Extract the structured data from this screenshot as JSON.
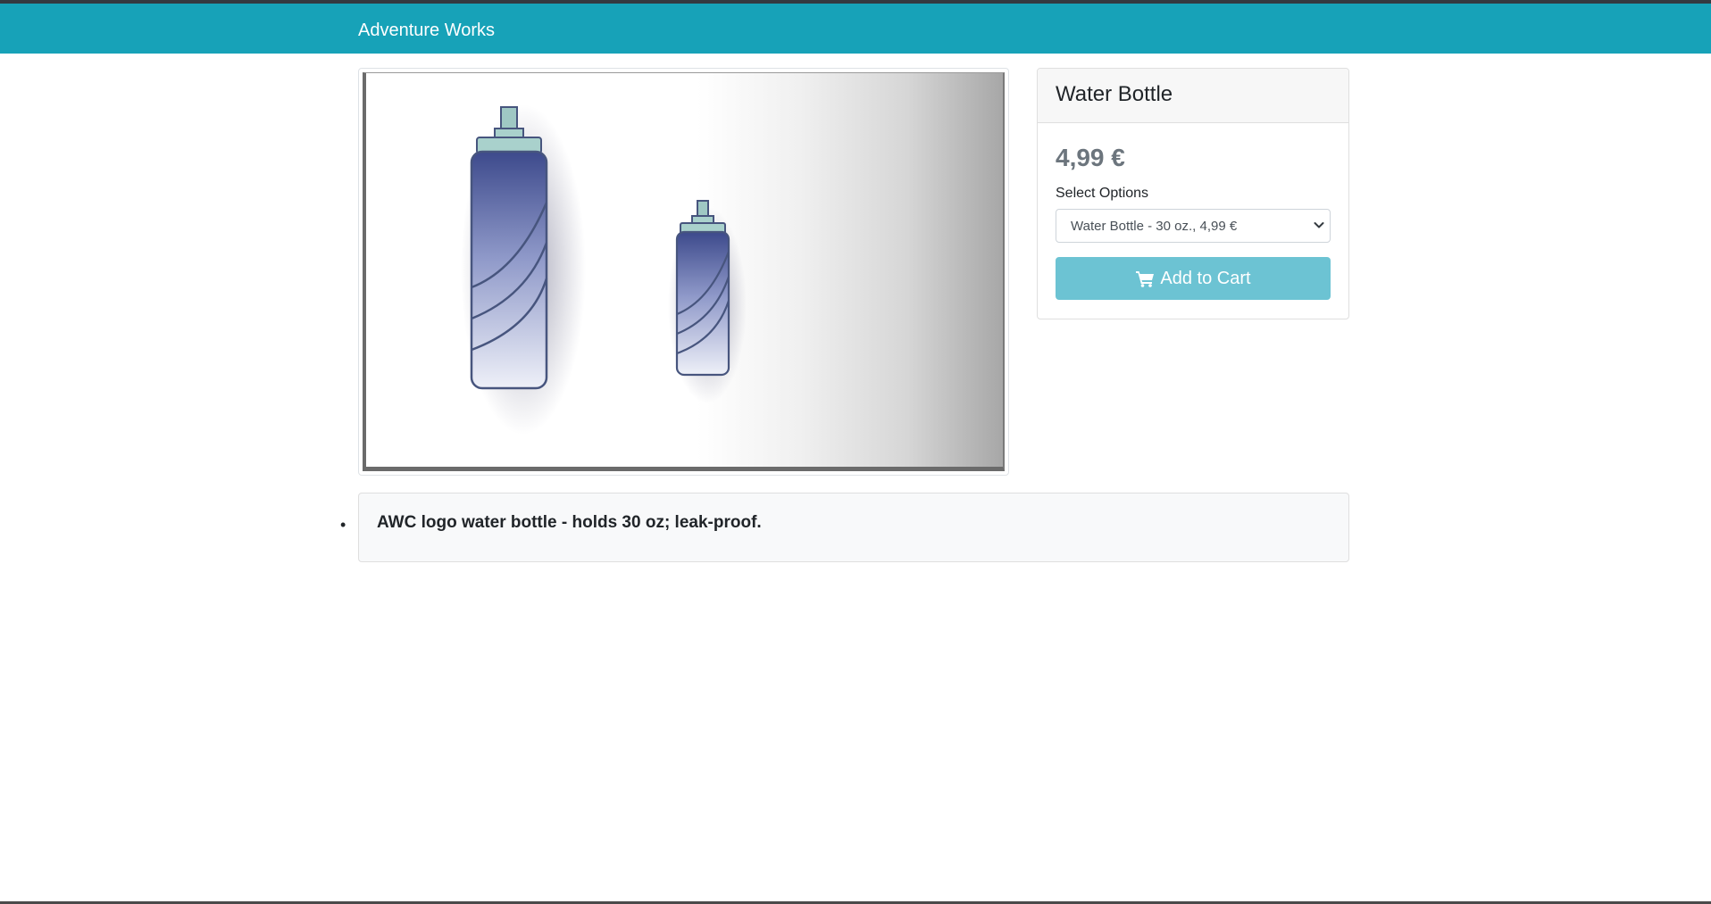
{
  "navbar": {
    "brand": "Adventure Works"
  },
  "product": {
    "image_alt": "Water Bottle product image",
    "title": "Water Bottle",
    "price": "4,99 €",
    "options_label": "Select Options",
    "selected_option": "Water Bottle - 30 oz., 4,99 €",
    "add_to_cart_label": "Add to Cart",
    "description": "AWC logo water bottle - holds 30 oz; leak-proof."
  },
  "colors": {
    "navbar": "#17a2b8",
    "button": "#6cc3d3",
    "price": "#6c757d"
  },
  "icons": {
    "cart": "shopping-cart-icon",
    "select": "chevron-down-icon"
  }
}
